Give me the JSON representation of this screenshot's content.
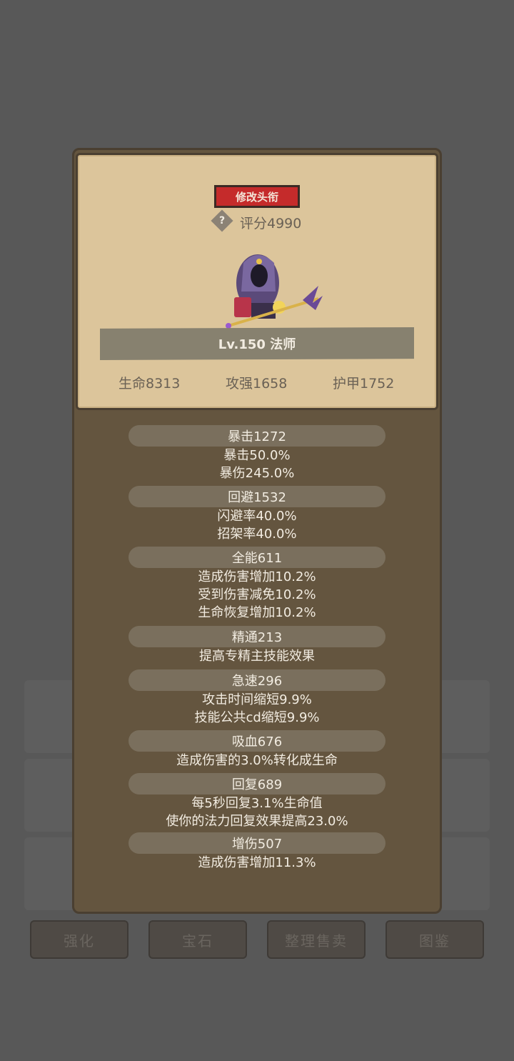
{
  "header": {
    "title_button": "修改头衔",
    "help_icon": "?",
    "score": "评分4990"
  },
  "hero": {
    "level_class": "Lv.150 法师",
    "hp": "生命8313",
    "attack": "攻强1658",
    "armor": "护甲1752"
  },
  "stats": {
    "crit": {
      "head": "暴击1272",
      "lines": [
        "暴击50.0%",
        "暴伤245.0%"
      ]
    },
    "dodge": {
      "head": "回避1532",
      "lines": [
        "闪避率40.0%",
        "招架率40.0%"
      ]
    },
    "versatility": {
      "head": "全能611",
      "lines": [
        "造成伤害增加10.2%",
        "受到伤害减免10.2%",
        "生命恢复增加10.2%"
      ]
    },
    "mastery": {
      "head": "精通213",
      "lines": [
        "提高专精主技能效果"
      ]
    },
    "haste": {
      "head": "急速296",
      "lines": [
        "攻击时间缩短9.9%",
        "技能公共cd缩短9.9%"
      ]
    },
    "lifesteal": {
      "head": "吸血676",
      "lines": [
        "造成伤害的3.0%转化成生命"
      ]
    },
    "regen": {
      "head": "回复689",
      "lines": [
        "每5秒回复3.1%生命值",
        "使你的法力回复效果提高23.0%"
      ]
    },
    "damage_bonus": {
      "head": "增伤507",
      "lines": [
        "造成伤害增加11.3%"
      ]
    }
  },
  "bottom_bar": {
    "enhance": "强化",
    "gem": "宝石",
    "sort_sell": "整理售卖",
    "codex": "图鉴"
  }
}
